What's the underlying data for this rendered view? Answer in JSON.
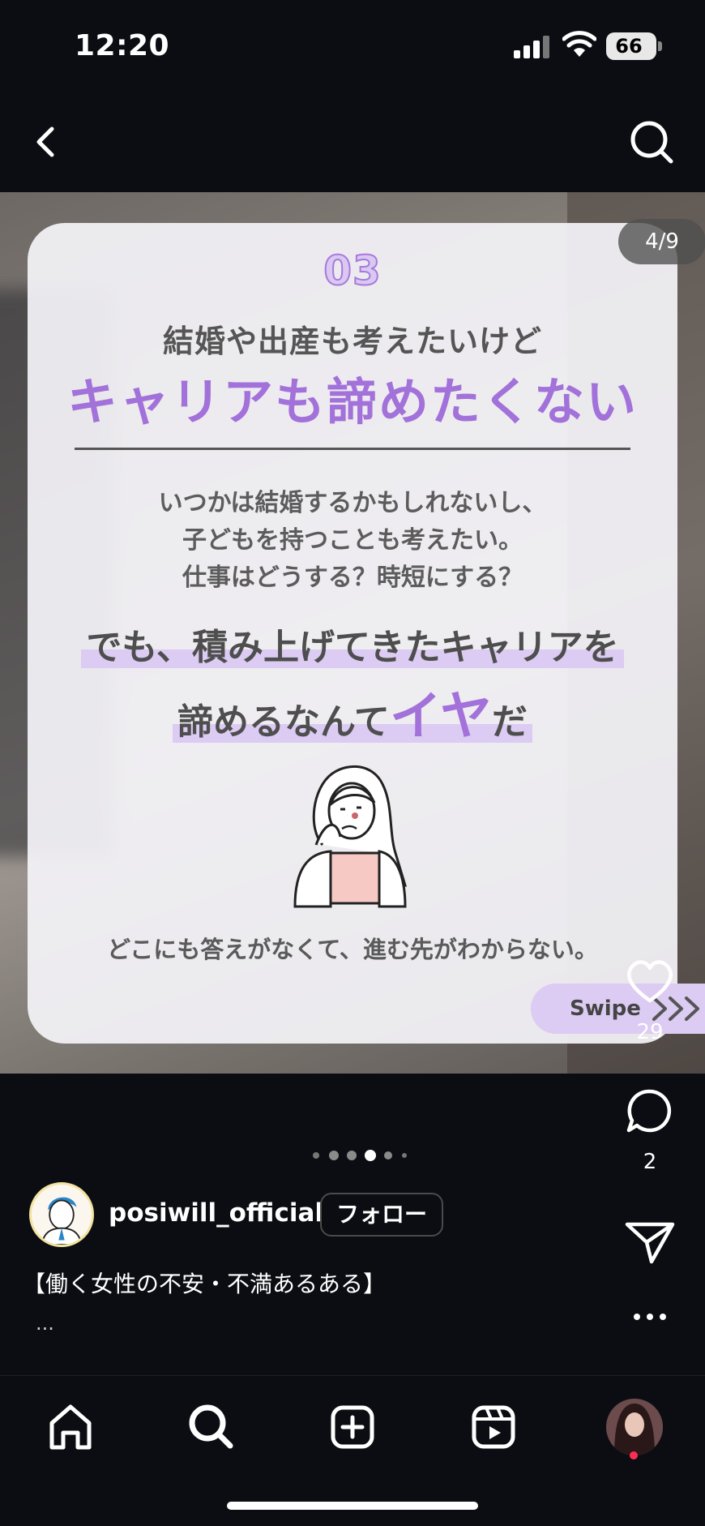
{
  "status_bar": {
    "time": "12:20",
    "battery": "66"
  },
  "post": {
    "slide_counter": "4/9",
    "card": {
      "number": "03",
      "subtitle": "結婚や出産も考えたいけど",
      "headline": "キャリアも諦めたくない",
      "paragraph_lines": [
        "いつかは結婚するかもしれないし、",
        "子どもを持つことも考えたい。",
        "仕事はどうする？時短にする？"
      ],
      "emphasis_line1": "でも、積み上げてきたキャリアを",
      "emphasis_line2_a": "諦めるなんて",
      "emphasis_line2_b": "イヤ",
      "emphasis_line2_c": "だ",
      "bottom_line": "どこにも答えがなくて、進む先がわからない。",
      "swipe_label": "Swipe"
    },
    "like_count": "29",
    "comment_count": "2",
    "carousel": {
      "total": 6,
      "active_index": 3
    }
  },
  "author": {
    "username": "posiwill_official",
    "follow_label": "フォロー"
  },
  "caption": {
    "text": "【働く女性の不安・不満あるある】",
    "more": "..."
  },
  "icons": {
    "back": "chevron-left-icon",
    "search": "search-icon",
    "like": "heart-icon",
    "comment": "comment-icon",
    "share": "send-icon",
    "more": "more-horizontal-icon",
    "home": "home-icon",
    "create": "plus-square-icon",
    "reels": "reels-icon"
  },
  "colors": {
    "accent_purple": "#a271d9",
    "highlight_purple": "#dccbf2",
    "background": "#0b0d12",
    "notification_dot": "#ff2d55"
  }
}
